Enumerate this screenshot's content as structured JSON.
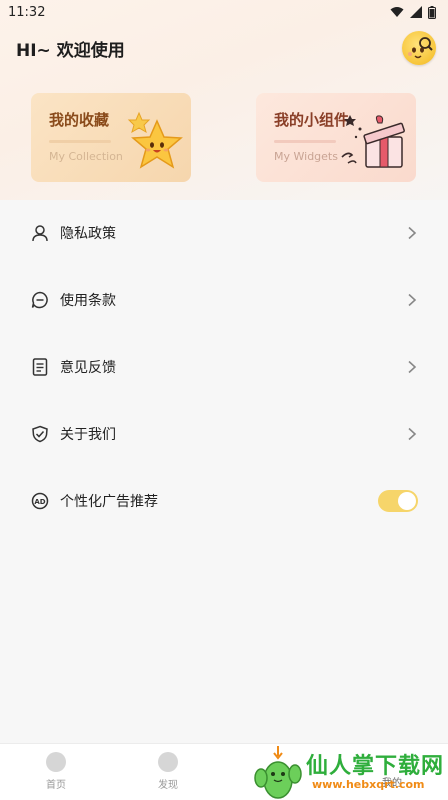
{
  "status_bar": {
    "time": "11:32"
  },
  "header": {
    "greeting": "HI~ 欢迎使用"
  },
  "cards": [
    {
      "title": "我的收藏",
      "subtitle": "My Collection"
    },
    {
      "title": "我的小组件",
      "subtitle": "My Widgets"
    }
  ],
  "menu": [
    {
      "label": "隐私政策",
      "icon": "person-icon"
    },
    {
      "label": "使用条款",
      "icon": "chat-bubble-icon"
    },
    {
      "label": "意见反馈",
      "icon": "document-icon"
    },
    {
      "label": "关于我们",
      "icon": "shield-check-icon"
    },
    {
      "label": "个性化广告推荐",
      "icon": "ad-icon",
      "toggle_on": true
    }
  ],
  "bottom_nav": [
    {
      "label": "首页"
    },
    {
      "label": "发现"
    },
    {
      "label": "我的"
    }
  ],
  "watermark": {
    "title": "仙人掌下载网",
    "url": "www.hebxqrt.com"
  },
  "colors": {
    "toggle": "#f6d56a",
    "accent_green": "#2fae3c"
  }
}
